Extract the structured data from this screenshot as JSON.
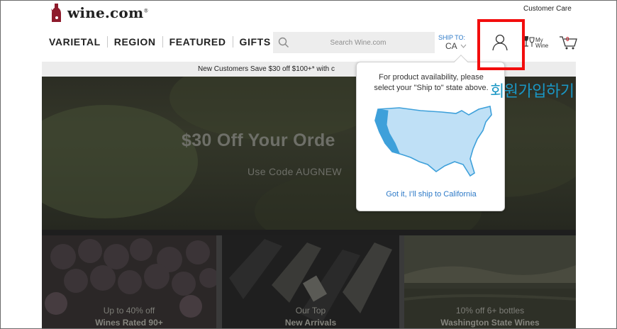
{
  "header": {
    "logo_text": "wine.com",
    "customer_care": "Customer Care",
    "nav": [
      "VARIETAL",
      "REGION",
      "FEATURED",
      "GIFTS"
    ],
    "search_placeholder": "Search Wine.com",
    "ship_to_label": "SHIP TO:",
    "ship_to_state": "CA",
    "mywine_label_1": "My",
    "mywine_label_2": "Wine",
    "cart_count": "0",
    "icons": [
      "search-icon",
      "account-icon",
      "mywine-icon",
      "cart-icon",
      "chevron-down-icon"
    ]
  },
  "promo_bar": {
    "text": "New Customers Save $30 off $100+* with c"
  },
  "hero": {
    "title": "$30 Off Your Orde",
    "subtitle": "Use Code AUGNEW"
  },
  "tiles": [
    {
      "title": "Up to 40% off",
      "subtitle": "Wines Rated 90+"
    },
    {
      "title": "Our Top",
      "subtitle": "New Arrivals"
    },
    {
      "title": "10% off 6+ bottles",
      "subtitle": "Washington State Wines"
    }
  ],
  "popover": {
    "message_line1": "For product availability, please",
    "message_line2": "select your \"Ship to\" state above.",
    "link": "Got it, I'll ship to California",
    "map_fill": "#bfe0f6",
    "map_stroke": "#3ea0da",
    "highlight": "#3ea0da"
  },
  "annotation": {
    "korean_label": "회원가입하기",
    "box_color": "#f20d0d",
    "label_color": "#1a97c5"
  }
}
